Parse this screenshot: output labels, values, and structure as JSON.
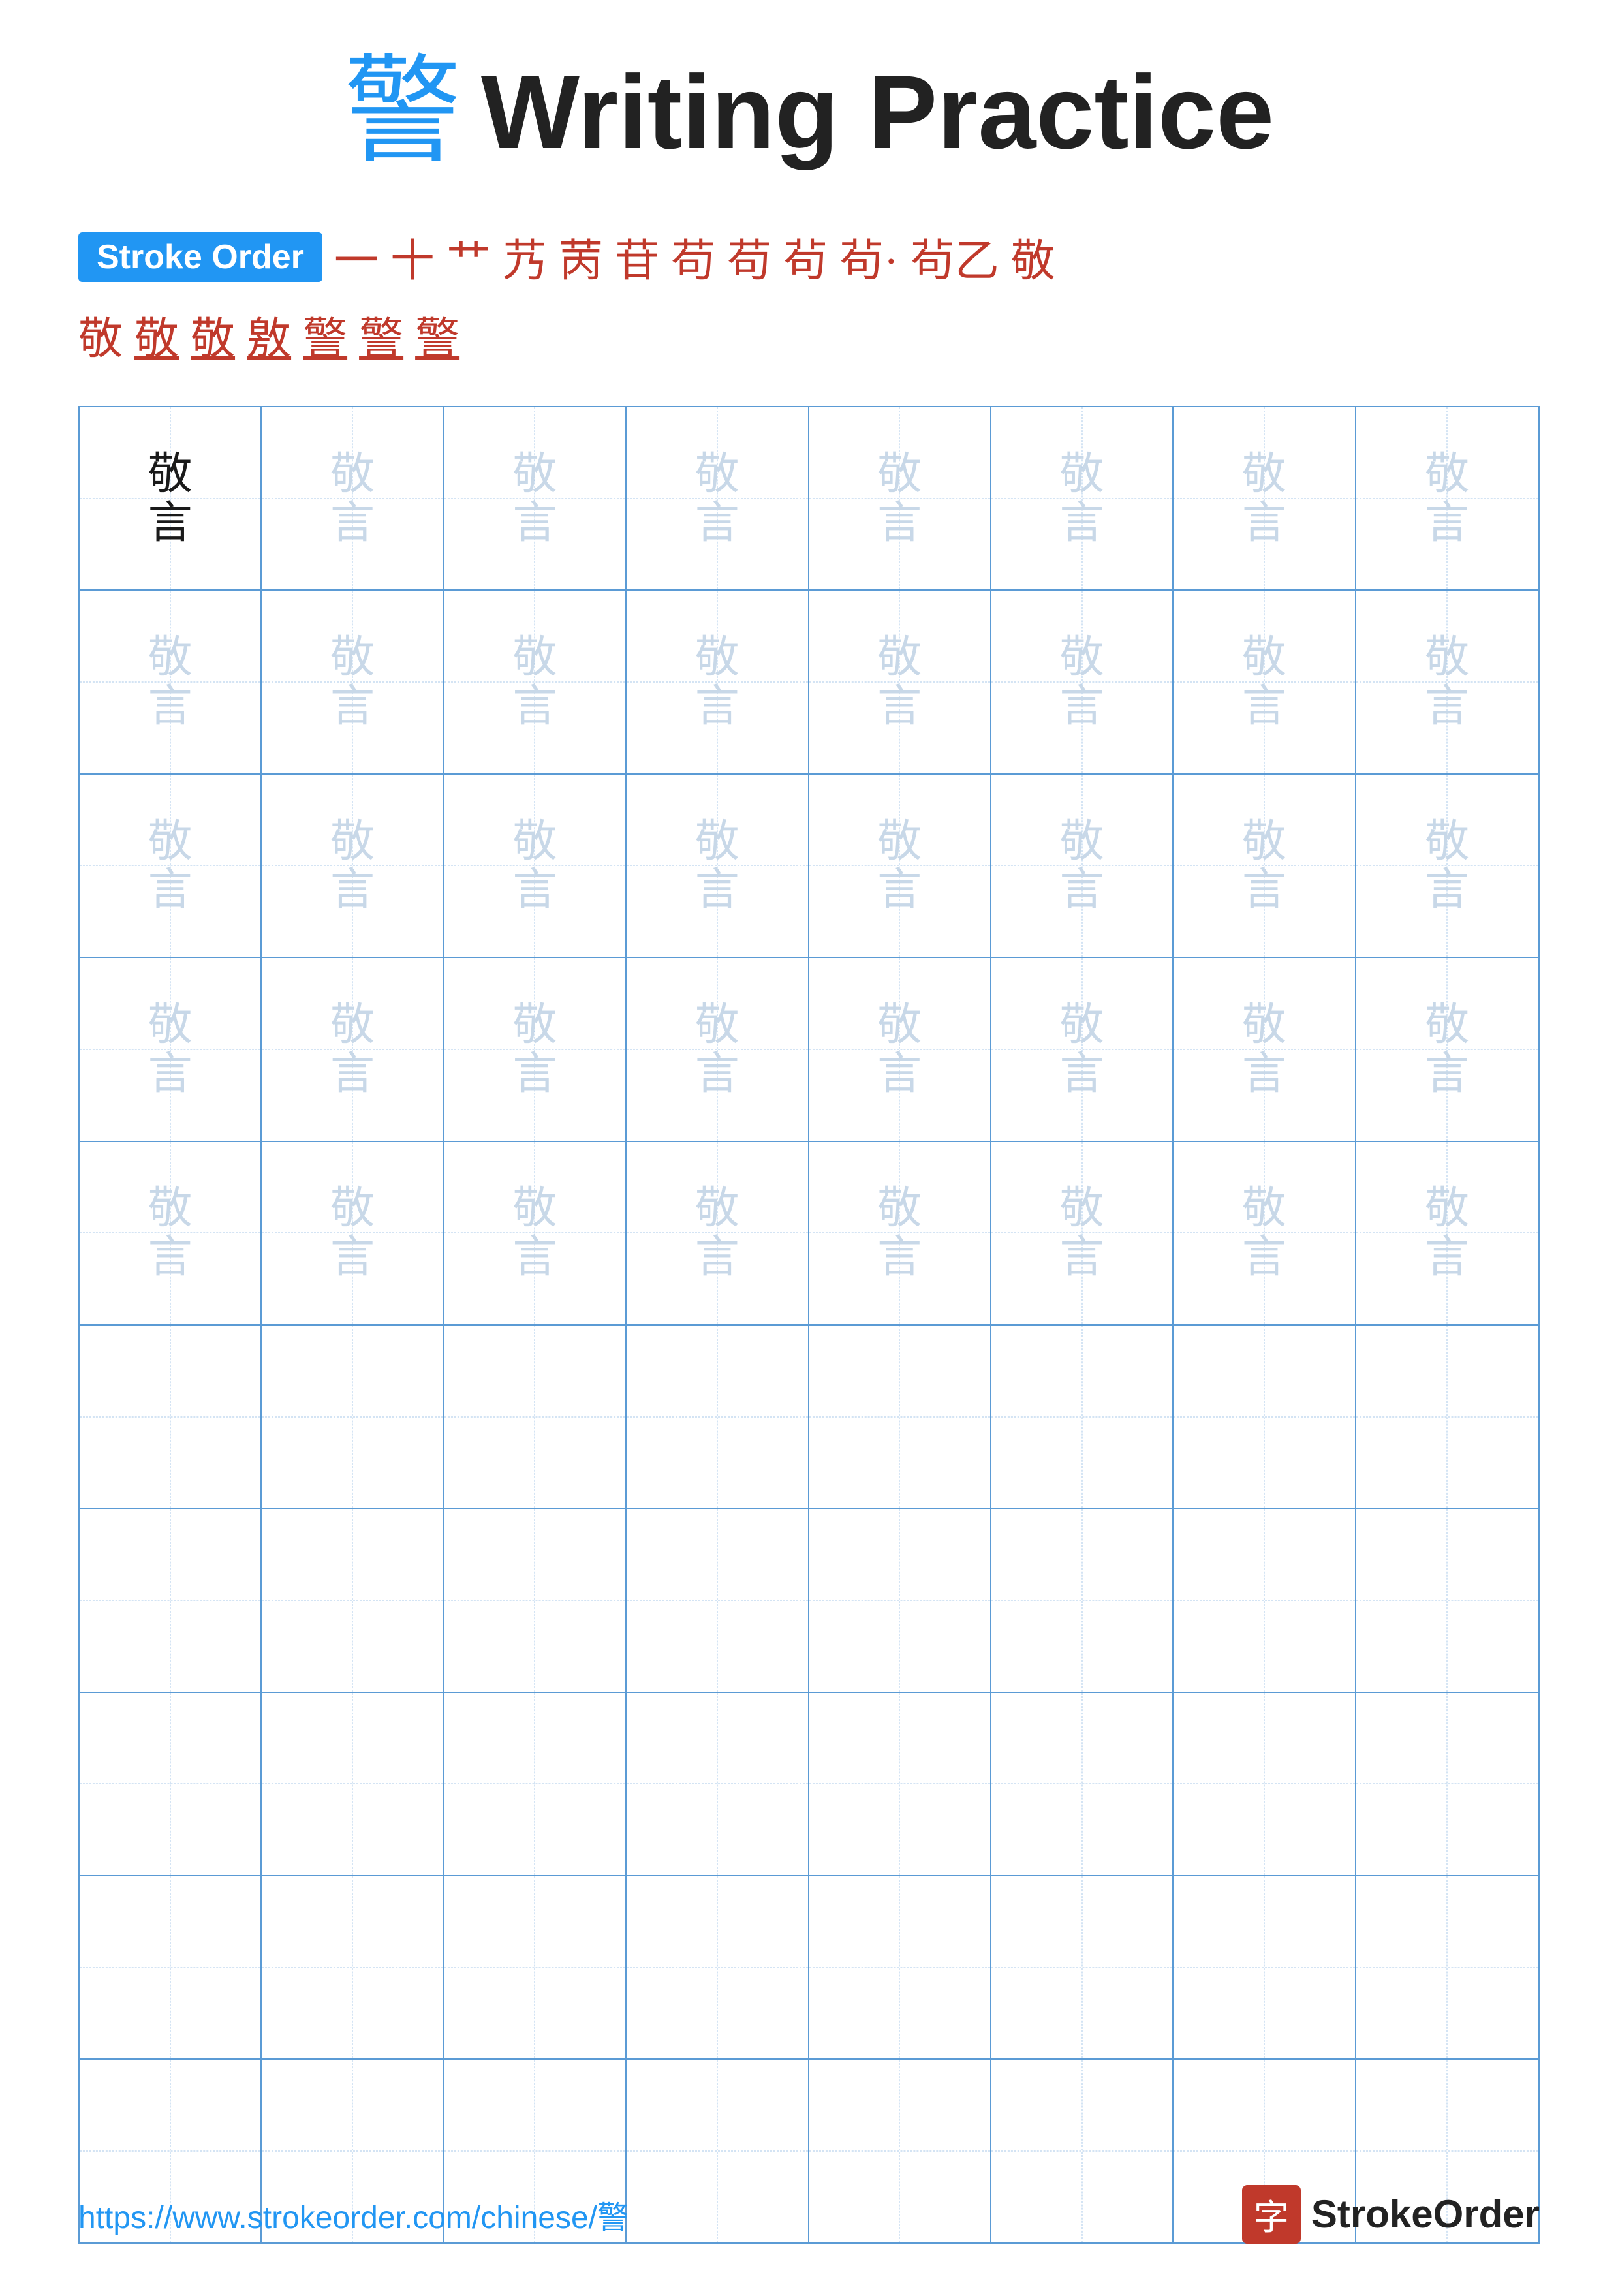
{
  "title": {
    "char": "警",
    "text": "Writing Practice"
  },
  "stroke_order": {
    "badge_label": "Stroke Order",
    "steps_row1": [
      "一",
      "十",
      "艹",
      "艿",
      "苪",
      "苷",
      "苟",
      "苟",
      "茍",
      "茍·",
      "茍乙",
      "敬"
    ],
    "steps_row2": [
      "敬",
      "敬",
      "敬",
      "敫",
      "警",
      "警",
      "警"
    ]
  },
  "grid": {
    "rows": 10,
    "cols": 8,
    "filled_rows": 5,
    "char_top": "敬",
    "char_bottom": "言"
  },
  "footer": {
    "url": "https://www.strokeorder.com/chinese/警",
    "logo_char": "字",
    "logo_text": "StrokeOrder"
  }
}
